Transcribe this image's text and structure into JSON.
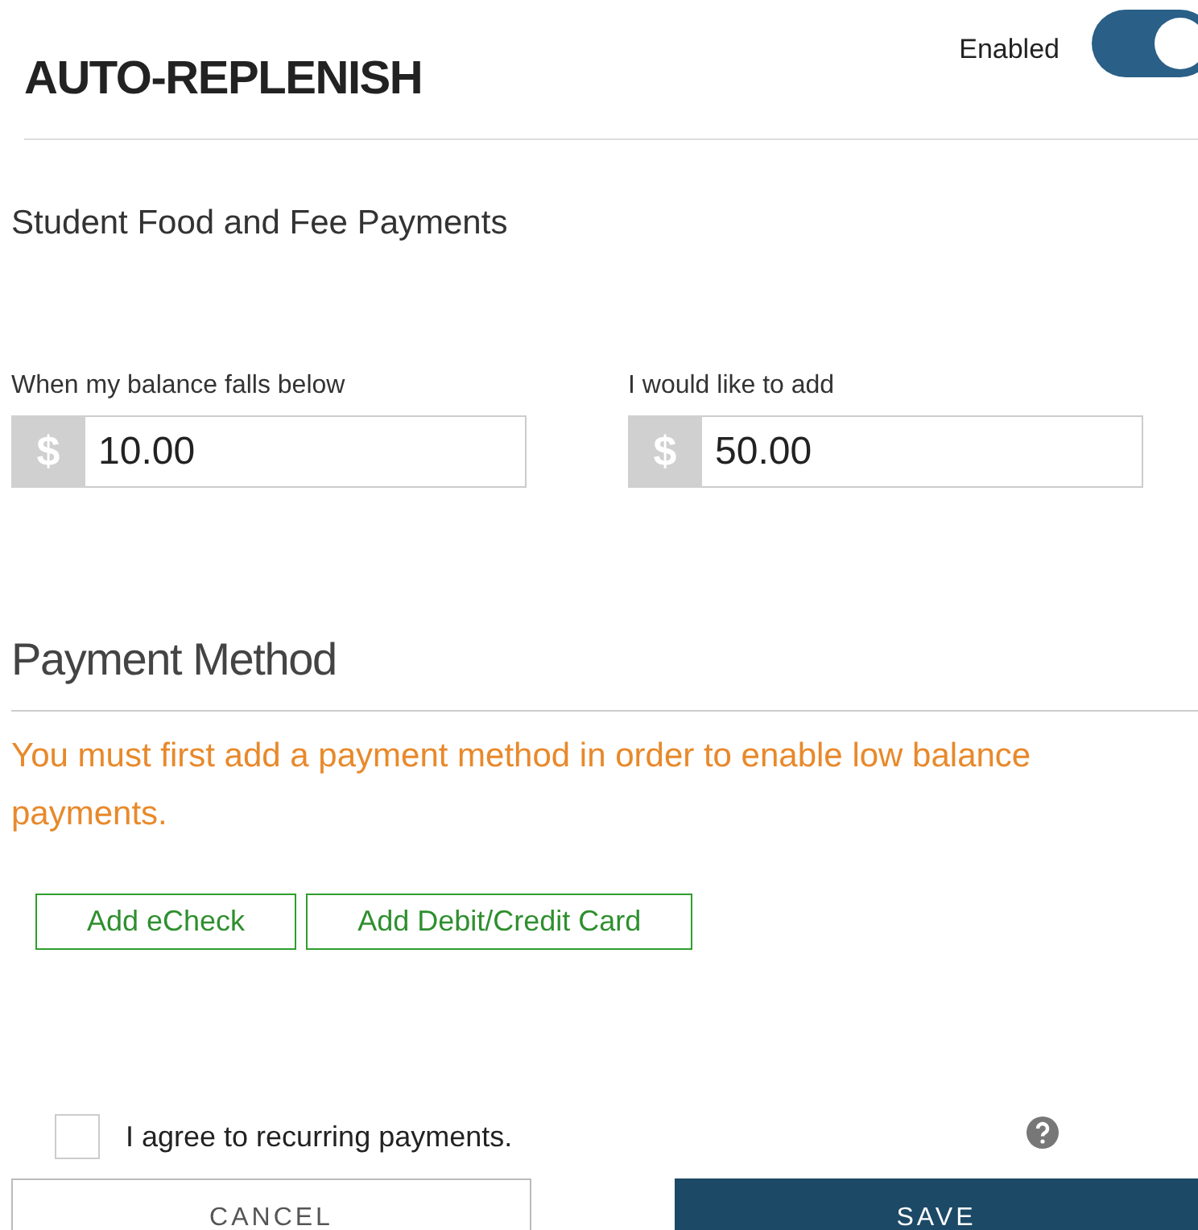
{
  "header": {
    "title": "AUTO-REPLENISH",
    "toggle": {
      "label": "Enabled",
      "on": true
    }
  },
  "account": {
    "name": "Student Food and Fee Payments"
  },
  "fields": [
    {
      "label": "When my balance falls below",
      "prefix": "$",
      "value": "10.00"
    },
    {
      "label": "I would like to add",
      "prefix": "$",
      "value": "50.00"
    }
  ],
  "payment_method": {
    "heading": "Payment Method",
    "warning": "You must first add a payment method in order to enable low balance payments.",
    "buttons": [
      "Add eCheck",
      "Add Debit/Credit Card"
    ]
  },
  "agreement": {
    "label": "I agree to recurring payments.",
    "checked": false
  },
  "actions": {
    "cancel": "CANCEL",
    "save": "SAVE"
  }
}
